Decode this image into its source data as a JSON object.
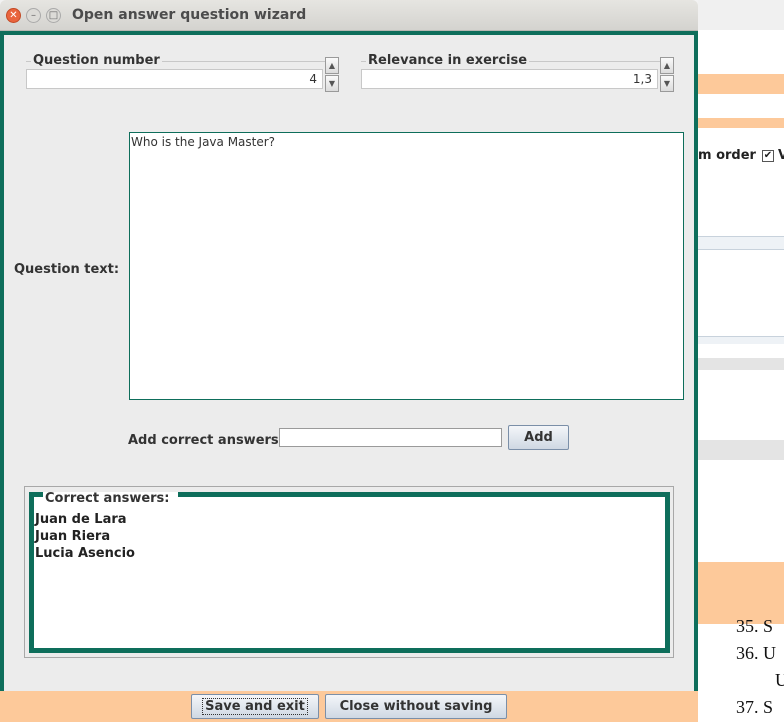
{
  "window": {
    "title": "Open answer question wizard",
    "controls": [
      "close",
      "minimize",
      "maximize"
    ]
  },
  "question_number": {
    "label": "Question number",
    "value": "4"
  },
  "relevance": {
    "label": "Relevance in exercise",
    "value": "1,3"
  },
  "question_text": {
    "label": "Question text:",
    "value": "Who is the Java Master?"
  },
  "add_answer": {
    "label": "Add correct answers",
    "value": "",
    "button": "Add"
  },
  "correct_answers": {
    "label": "Correct answers:",
    "items": [
      "Juan de Lara",
      "Juan Riera",
      "Lucia Asencio"
    ]
  },
  "footer": {
    "save_button": "Save and exit",
    "close_button": "Close without saving"
  },
  "background": {
    "order_text": "m order",
    "checkbox_label": "V",
    "list_items": [
      "35. S",
      "36. U",
      "U",
      "37. S"
    ]
  },
  "colors": {
    "accent_frame": "#0e6e5b",
    "footer_bg": "#fdc99a",
    "close_button": "#e9643d"
  }
}
